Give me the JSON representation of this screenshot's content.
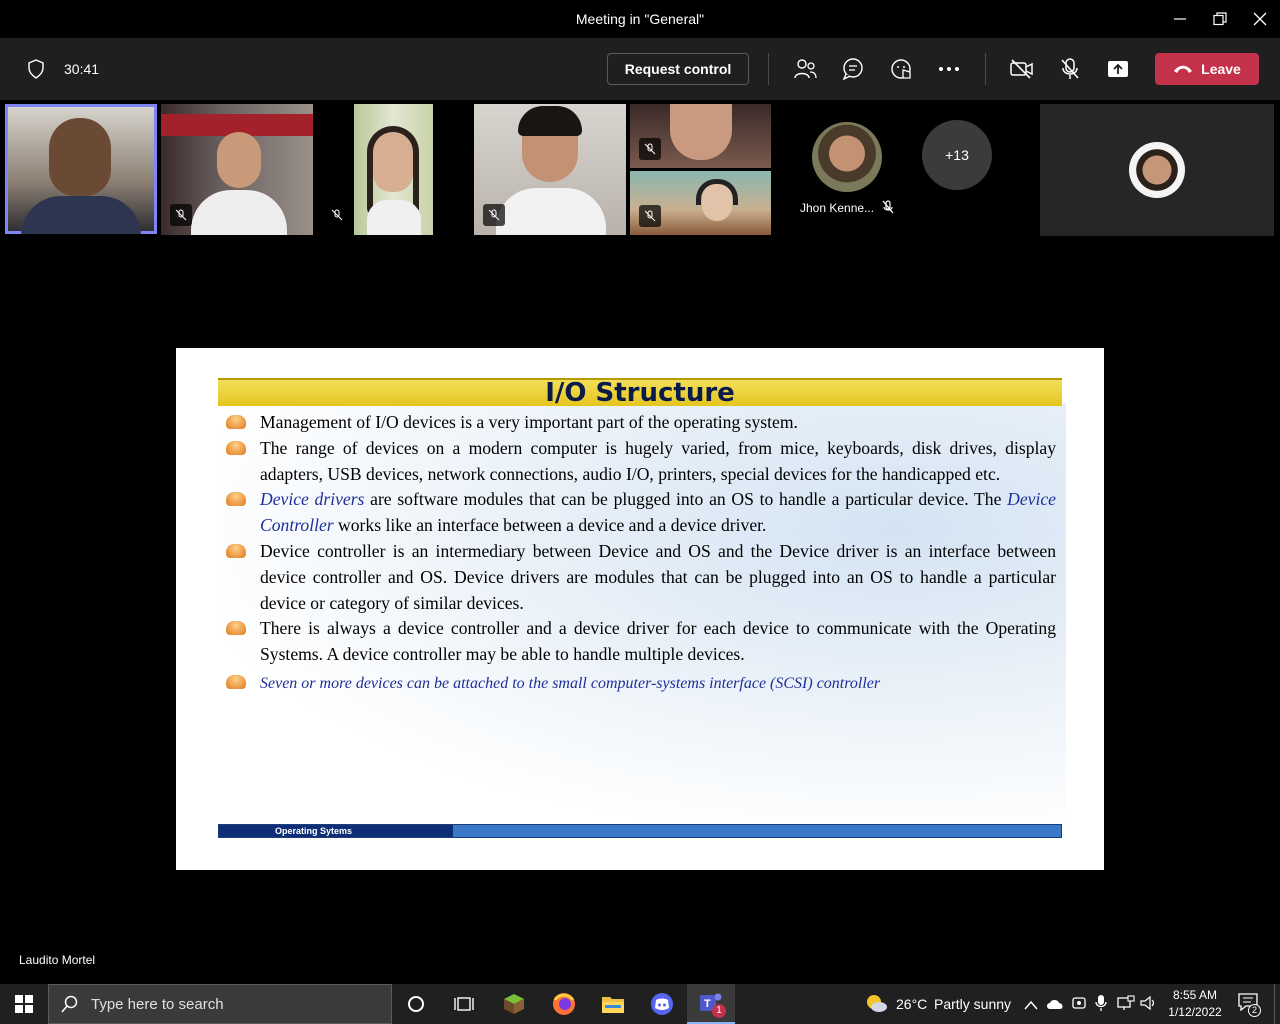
{
  "window": {
    "title": "Meeting in \"General\""
  },
  "controls": {
    "timer": "30:41",
    "request_control": "Request control",
    "leave": "Leave"
  },
  "participants": {
    "overflow_count": "+13",
    "named_participant": "Jhon Kenne..."
  },
  "slide": {
    "title": "I/O Structure",
    "bullets": [
      "Management of I/O devices is a very important part of the operating system.",
      "The range of devices on a modern computer is hugely varied, from mice, keyboards, disk drives, display adapters, USB devices, network connections, audio I/O, printers, special devices for the handicapped etc.",
      {
        "em1": "Device drivers",
        "t1": " are software modules that can be plugged into an OS to handle a particular device. The ",
        "em2": "Device Controller",
        "t2": " works like an interface between a device and a device driver."
      },
      "Device controller is an intermediary between Device and OS and the Device driver is an interface between device controller and OS. Device drivers are modules that can be plugged into an OS to handle a particular device or category of similar devices.",
      "There is always a device controller and a device driver for each device to communicate with the Operating Systems. A device controller may be able to handle multiple devices.",
      "Seven or more devices can be attached to the small computer-systems interface (SCSI) controller"
    ],
    "footer": "Operating Sytems"
  },
  "presenter": "Laudito Mortel",
  "taskbar": {
    "search_placeholder": "Type here to search",
    "weather_temp": "26°C",
    "weather_desc": "Partly sunny",
    "time": "8:55 AM",
    "date": "1/12/2022",
    "notification_count": "2",
    "teams_badge": "1"
  },
  "colors": {
    "leave_red": "#c4314b",
    "active_outline": "#7f85f5",
    "slide_title_yellow": "#e5c61f",
    "slide_footer_blue": "#3b78c8"
  }
}
